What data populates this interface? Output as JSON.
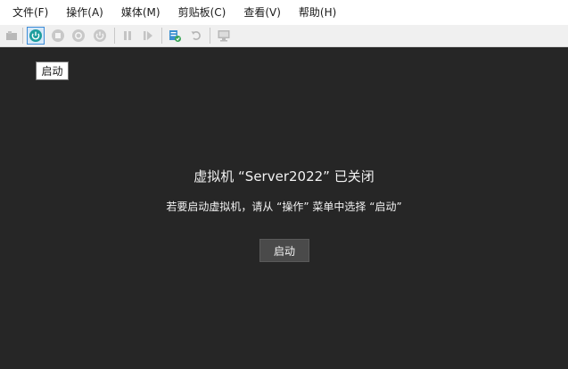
{
  "menu": [
    "文件(F)",
    "操作(A)",
    "媒体(M)",
    "剪贴板(C)",
    "查看(V)",
    "帮助(H)"
  ],
  "toolbar": {
    "icons": [
      "settings-icon",
      "start-icon",
      "stop-icon",
      "shutdown-icon",
      "power-icon",
      "pause-icon",
      "resume-icon",
      "checkpoint-icon",
      "revert-icon",
      "enhanced-session-icon"
    ]
  },
  "tooltip": "启动",
  "main": {
    "title": "虚拟机 “Server2022” 已关闭",
    "subtitle": "若要启动虚拟机，请从 “操作” 菜单中选择 “启动”",
    "start_button": "启动"
  },
  "colors": {
    "background": "#262626",
    "accent": "#1e9e9e"
  }
}
